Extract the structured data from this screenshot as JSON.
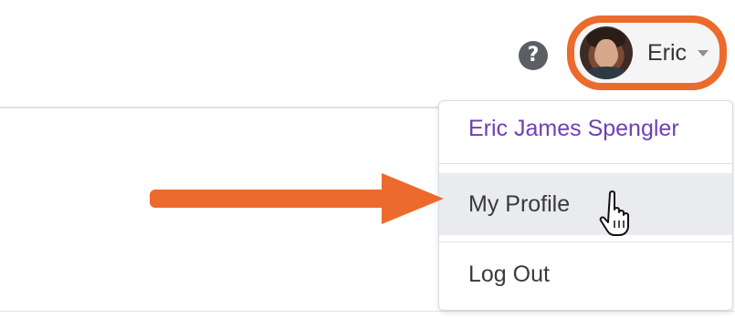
{
  "header": {
    "help_icon": "question-circle-icon",
    "user_menu": {
      "short_name": "Eric",
      "avatar": "user-avatar",
      "caret_icon": "caret-down-icon",
      "highlight_color": "#ec6a2c"
    }
  },
  "dropdown": {
    "full_name": "Eric James Spengler",
    "full_name_color": "#6f3fb5",
    "items": [
      {
        "label": "My Profile",
        "hovered": true
      },
      {
        "label": "Log Out",
        "hovered": false
      }
    ]
  },
  "annotations": {
    "arrow_color": "#ec6a2c",
    "cursor_icon": "hand-pointer-icon"
  }
}
